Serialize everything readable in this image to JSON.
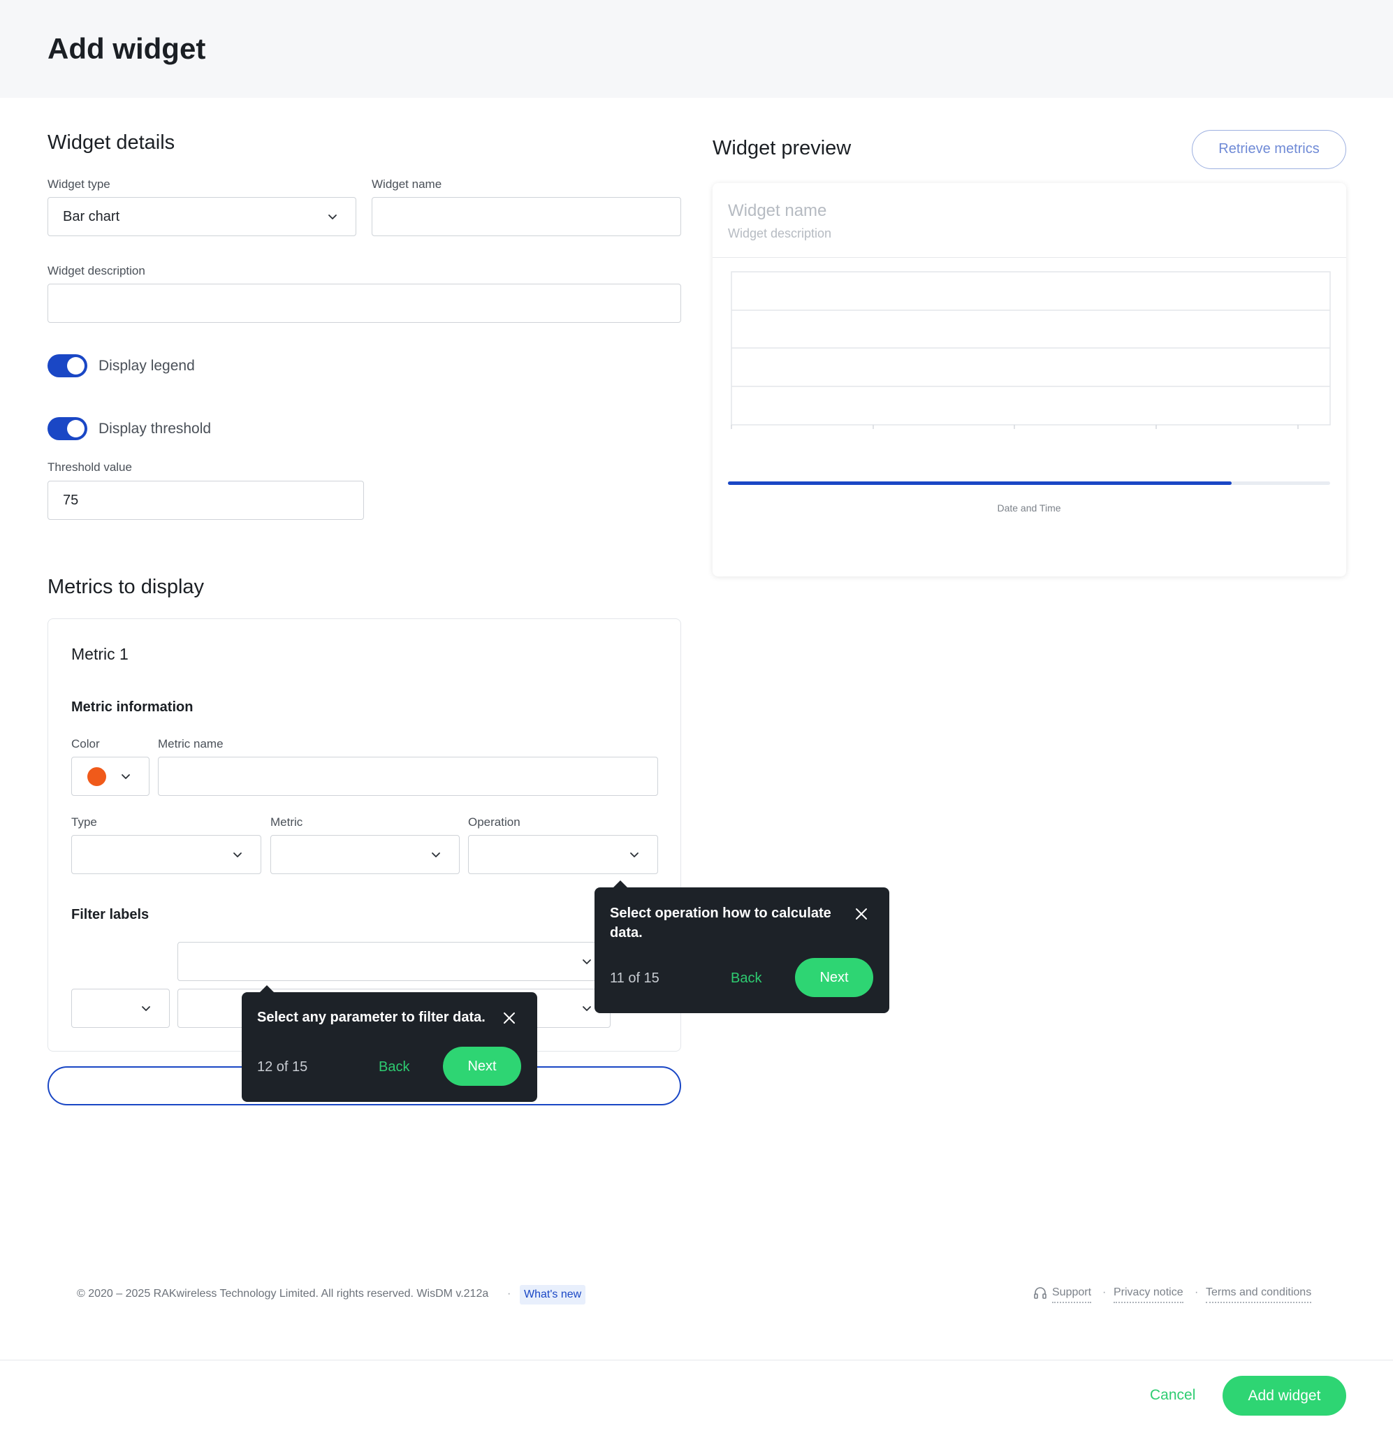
{
  "page": {
    "title": "Add widget"
  },
  "details": {
    "title": "Widget details",
    "widget_type_label": "Widget type",
    "widget_type_value": "Bar chart",
    "widget_name_label": "Widget name",
    "widget_description_label": "Widget description",
    "display_legend_label": "Display legend",
    "display_threshold_label": "Display threshold",
    "threshold_label": "Threshold value",
    "threshold_value": "75"
  },
  "metrics": {
    "title": "Metrics to display",
    "card_title": "Metric 1",
    "info_title": "Metric information",
    "color_label": "Color",
    "metric_name_label": "Metric name",
    "type_label": "Type",
    "metric_label": "Metric",
    "operation_label": "Operation",
    "filter_title": "Filter labels",
    "color_value": "#f05a1a"
  },
  "preview": {
    "title": "Widget preview",
    "retrieve_label": "Retrieve metrics",
    "widget_name": "Widget name",
    "widget_description": "Widget description",
    "x_axis_label": "Date and Time",
    "range_fill": 0.837
  },
  "tour_operation": {
    "text": "Select operation how to calculate data.",
    "step": "11 of 15",
    "back": "Back",
    "next": "Next"
  },
  "tour_filter": {
    "text": "Select any parameter to filter data.",
    "step": "12 of 15",
    "back": "Back",
    "next": "Next"
  },
  "footer": {
    "copyright": "© 2020 – 2025 RAKwireless Technology Limited. All rights reserved. WisDM v.212a",
    "separator": "·",
    "whats_new": "What's new",
    "support": "Support",
    "privacy": "Privacy notice",
    "terms": "Terms and conditions"
  },
  "actions": {
    "cancel": "Cancel",
    "add": "Add widget"
  },
  "colors": {
    "accent": "#1a47c5",
    "success": "#2ed573",
    "tooltip": "#1d2228"
  }
}
